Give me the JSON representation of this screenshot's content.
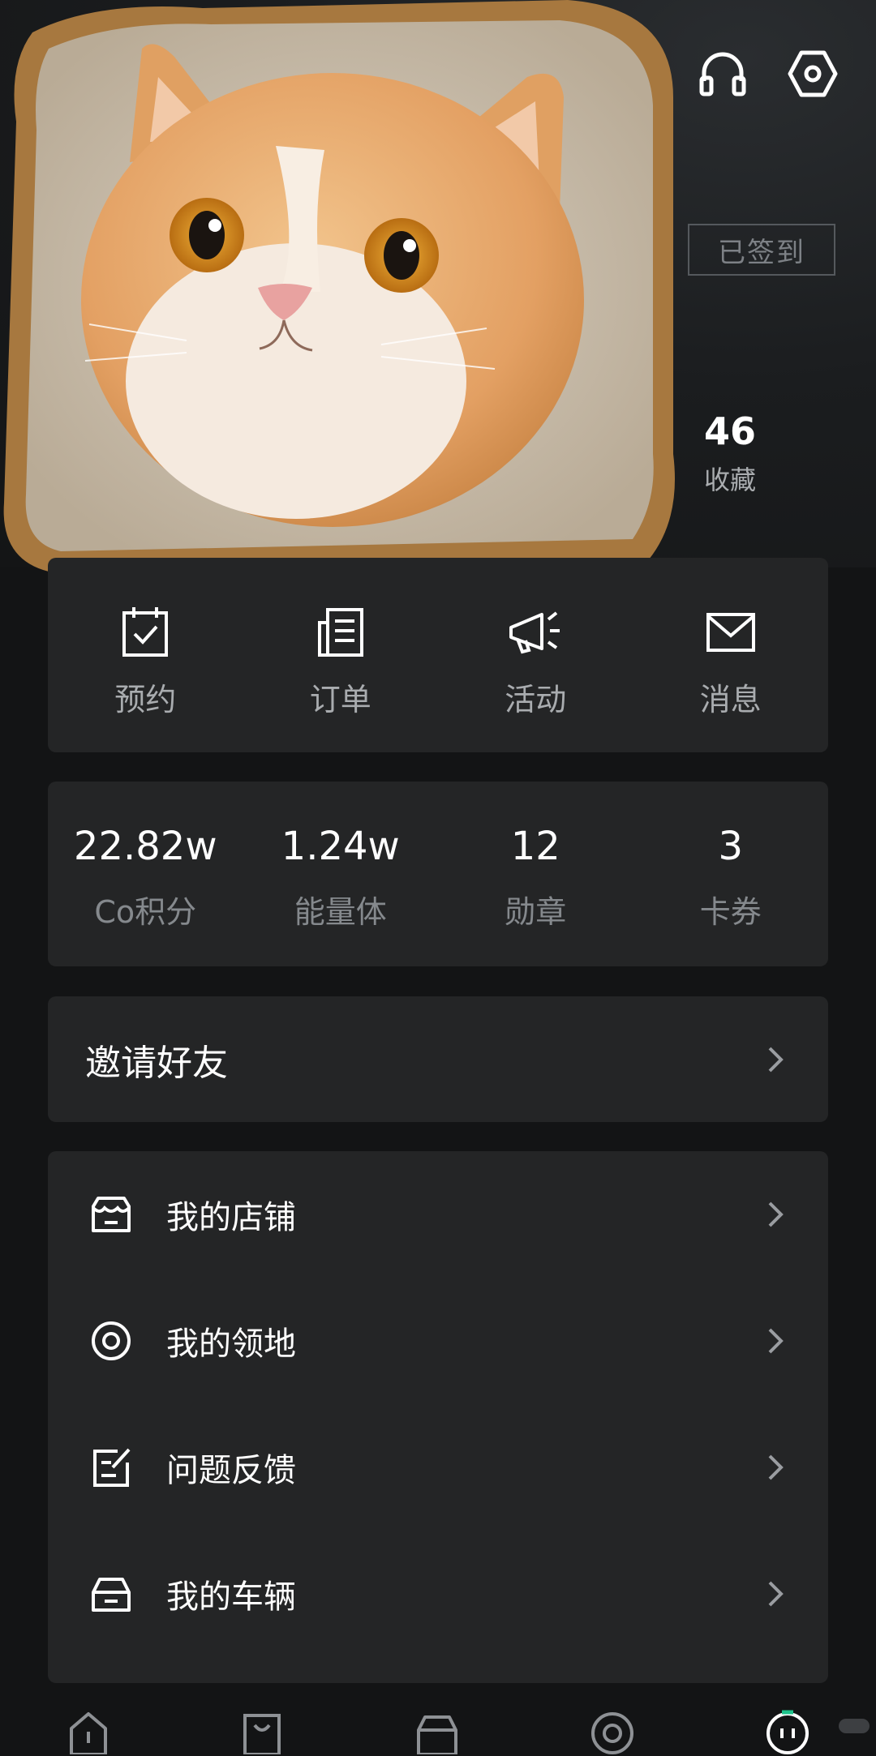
{
  "header": {
    "checkin_label": "已签到",
    "favorites": {
      "count": "46",
      "label": "收藏"
    }
  },
  "quick_actions": [
    {
      "label": "预约",
      "icon": "calendar-check-icon"
    },
    {
      "label": "订单",
      "icon": "document-icon"
    },
    {
      "label": "活动",
      "icon": "megaphone-icon"
    },
    {
      "label": "消息",
      "icon": "mail-icon"
    }
  ],
  "stats": [
    {
      "value": "22.82w",
      "label": "Co积分"
    },
    {
      "value": "1.24w",
      "label": "能量体"
    },
    {
      "value": "12",
      "label": "勋章"
    },
    {
      "value": "3",
      "label": "卡券"
    }
  ],
  "invite": {
    "label": "邀请好友"
  },
  "menu": [
    {
      "label": "我的店铺",
      "icon": "store-icon"
    },
    {
      "label": "我的领地",
      "icon": "target-icon"
    },
    {
      "label": "问题反馈",
      "icon": "feedback-icon"
    },
    {
      "label": "我的车辆",
      "icon": "car-icon"
    }
  ],
  "tabbar": [
    {
      "icon": "home-icon"
    },
    {
      "icon": "shop-bag-icon"
    },
    {
      "icon": "car-icon"
    },
    {
      "icon": "discover-icon"
    },
    {
      "icon": "profile-icon",
      "active": true
    }
  ],
  "colors": {
    "background": "#131415",
    "card": "#242526",
    "accent": "#1ec48c",
    "muted_text": "#a9acaf"
  }
}
